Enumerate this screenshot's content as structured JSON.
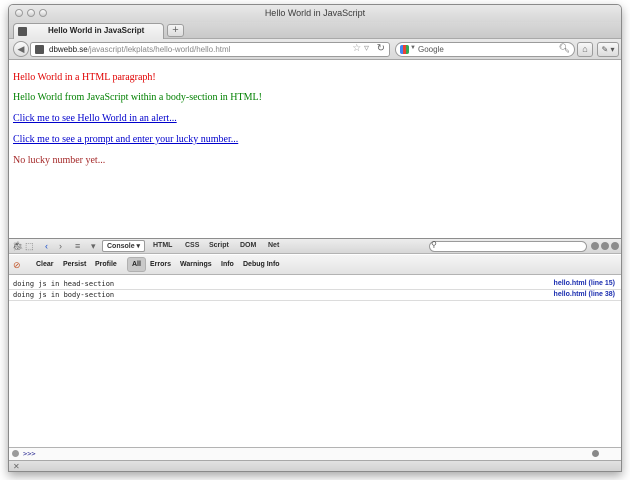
{
  "window": {
    "title": "Hello World in JavaScript"
  },
  "tab": {
    "label": "Hello World in JavaScript",
    "new_tab_glyph": "+"
  },
  "navbar": {
    "url_host": "dbwebb.se",
    "url_path": "/javascript/lekplats/hello-world/hello.html",
    "search_placeholder": "Google"
  },
  "page": {
    "paragraph_red": "Hello World in a HTML paragraph!",
    "paragraph_green": "Hello World from JavaScript within a body-section in HTML!",
    "link_alert": "Click me to see Hello World in an alert...",
    "link_prompt": "Click me to see a prompt and enter your lucky number...",
    "lucky_status": "No lucky number yet...",
    "colors": {
      "red": "#e00000",
      "green": "#008000",
      "link": "#0000cc",
      "status": "#a52a2a"
    }
  },
  "firebug": {
    "tabs": [
      "Console ▾",
      "HTML",
      "CSS",
      "Script",
      "DOM",
      "Net"
    ],
    "console_buttons": [
      "Clear",
      "Persist",
      "Profile"
    ],
    "filters": [
      "All",
      "Errors",
      "Warnings",
      "Info",
      "Debug Info"
    ],
    "log": [
      {
        "message": "doing js in head-section",
        "source": "hello.html (line 15)"
      },
      {
        "message": "doing js in body-section",
        "source": "hello.html (line 38)"
      }
    ],
    "command_prompt": ">>>"
  },
  "icons": [
    "traffic-light",
    "favicon",
    "back-arrow",
    "star",
    "reload",
    "google",
    "search",
    "home",
    "tools",
    "firebug",
    "inspect",
    "close"
  ]
}
